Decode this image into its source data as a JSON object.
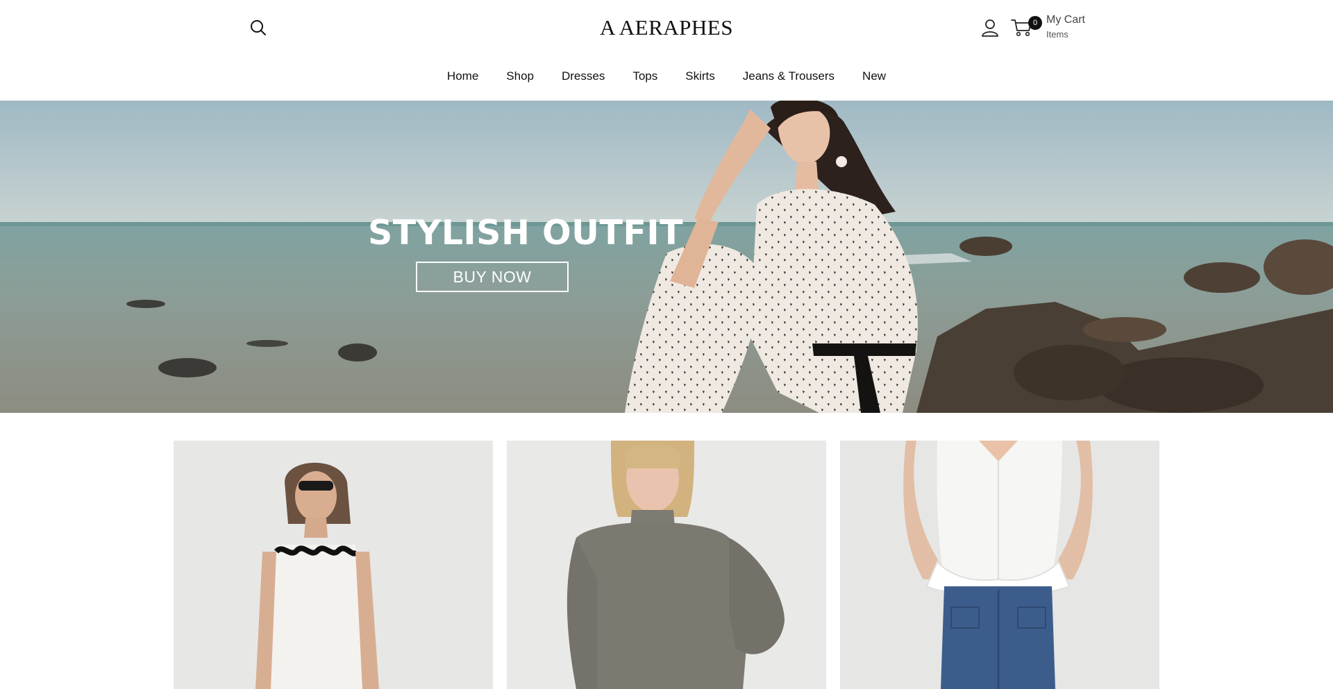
{
  "header": {
    "logo_text": "A AERAPHES",
    "search_icon": "search-icon",
    "account_icon": "user-icon",
    "cart": {
      "icon": "cart-icon",
      "count": "0",
      "title": "My Cart",
      "subtitle": "Items"
    }
  },
  "nav": {
    "items": [
      {
        "label": "Home"
      },
      {
        "label": "Shop"
      },
      {
        "label": "Dresses"
      },
      {
        "label": "Tops"
      },
      {
        "label": "Skirts"
      },
      {
        "label": "Jeans & Trousers"
      },
      {
        "label": "New"
      }
    ]
  },
  "hero": {
    "title": "STYLISH OUTFIT",
    "button_label": "BUY NOW"
  },
  "colors": {
    "text": "#111111",
    "background": "#ffffff",
    "badge": "#111111",
    "hero_button_border": "#ffffff"
  }
}
